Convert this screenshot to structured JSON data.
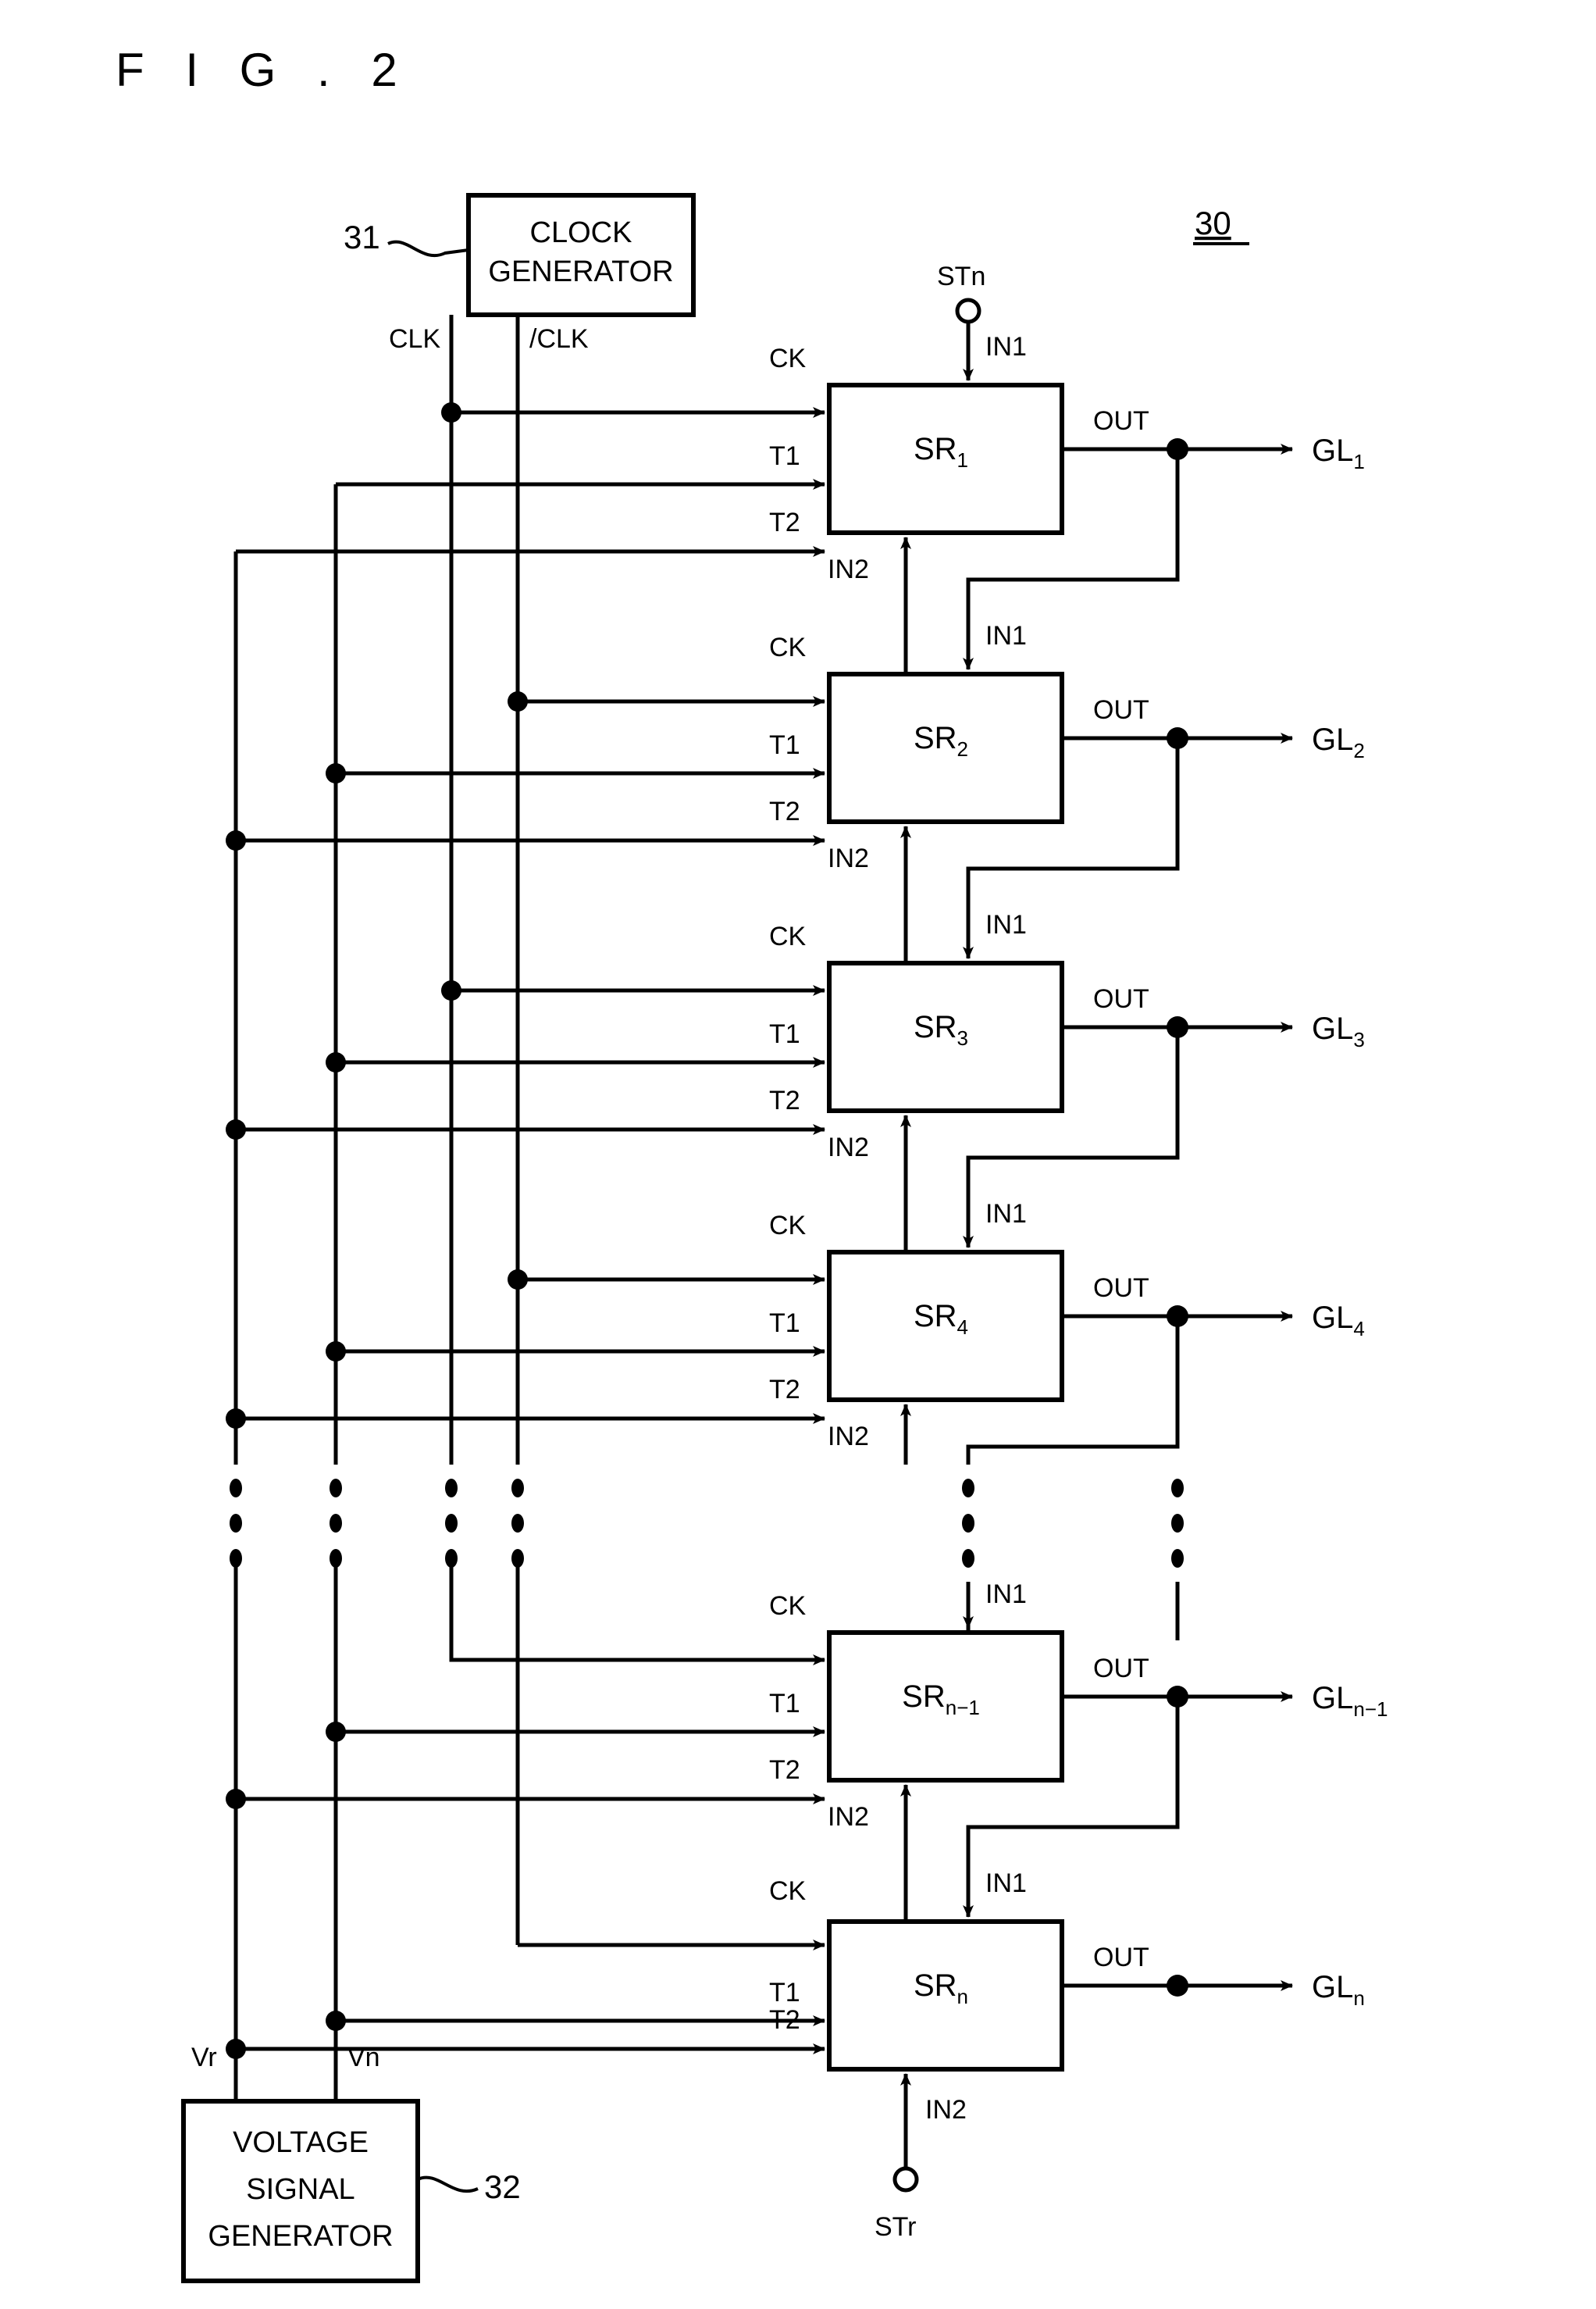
{
  "figure": {
    "title": "F I G .  2",
    "overall_ref": "30",
    "clock_generator": {
      "line1": "CLOCK",
      "line2": "GENERATOR",
      "ref": "31"
    },
    "voltage_generator": {
      "line1": "VOLTAGE",
      "line2": "SIGNAL",
      "line3": "GENERATOR",
      "ref": "32"
    },
    "clock_bus": {
      "clk": "CLK",
      "clk_bar": "/CLK"
    },
    "voltage_bus": {
      "vr": "Vr",
      "vn": "Vn"
    },
    "start_terminals": {
      "top": "STn",
      "bottom": "STr"
    },
    "port_labels": {
      "ck": "CK",
      "t1": "T1",
      "t2": "T2",
      "in1": "IN1",
      "in2": "IN2",
      "out": "OUT"
    },
    "stages": [
      {
        "name": "SR",
        "sub": "1",
        "gate_line": "GL",
        "gate_sub": "1",
        "clock_source": "CLK"
      },
      {
        "name": "SR",
        "sub": "2",
        "gate_line": "GL",
        "gate_sub": "2",
        "clock_source": "/CLK"
      },
      {
        "name": "SR",
        "sub": "3",
        "gate_line": "GL",
        "gate_sub": "3",
        "clock_source": "CLK"
      },
      {
        "name": "SR",
        "sub": "4",
        "gate_line": "GL",
        "gate_sub": "4",
        "clock_source": "/CLK"
      },
      {
        "name": "SR",
        "sub": "n−1",
        "gate_line": "GL",
        "gate_sub": "n−1",
        "clock_source": "CLK"
      },
      {
        "name": "SR",
        "sub": "n",
        "gate_line": "GL",
        "gate_sub": "n",
        "clock_source": "/CLK"
      }
    ],
    "ellipsis": "⋮"
  }
}
